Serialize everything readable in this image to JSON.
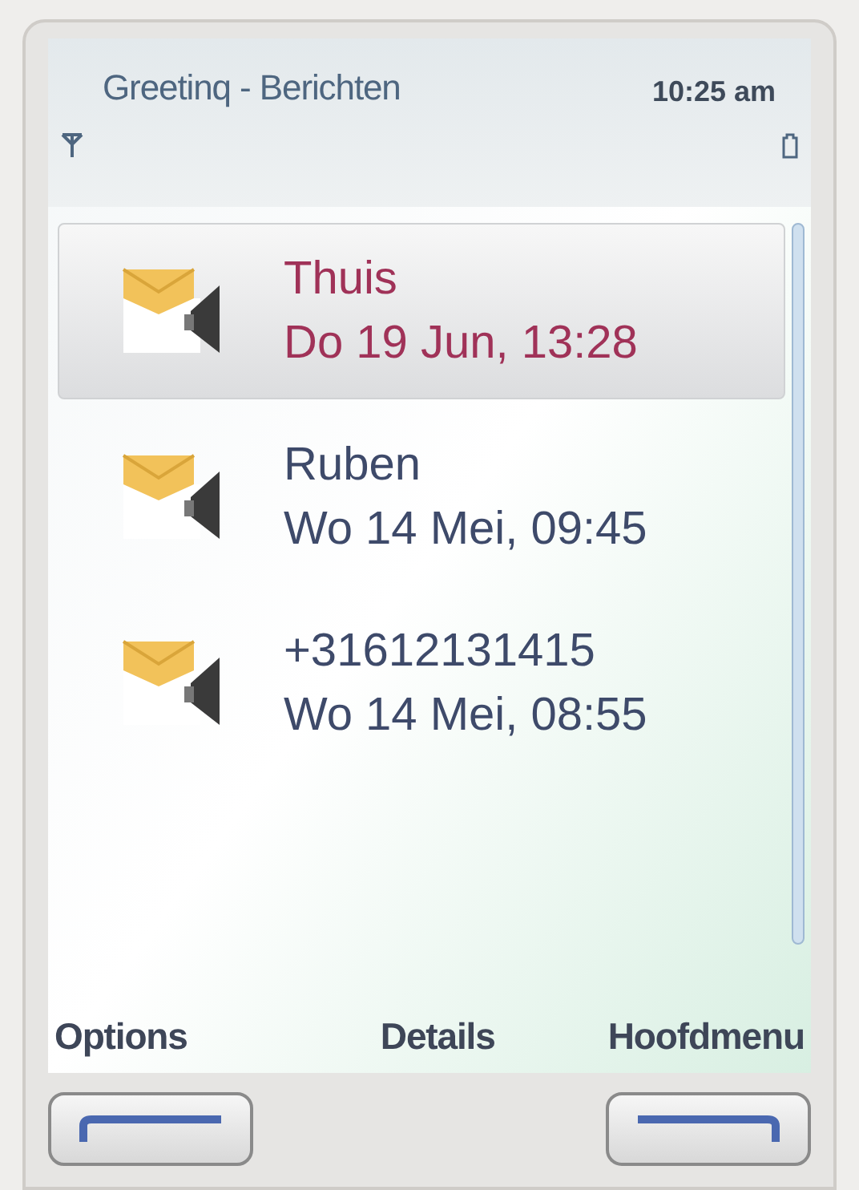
{
  "status_bar": {
    "title": "Greetinq - Berichten",
    "time": "10:25 am"
  },
  "messages": [
    {
      "sender": "Thuis",
      "date": "Do 19 Jun, 13:28",
      "selected": true
    },
    {
      "sender": "Ruben",
      "date": "Wo 14 Mei, 09:45",
      "selected": false
    },
    {
      "sender": "+31612131415",
      "date": "Wo 14 Mei, 08:55",
      "selected": false
    }
  ],
  "softkeys": {
    "left": "Options",
    "middle": "Details",
    "right": "Hoofdmenu"
  }
}
